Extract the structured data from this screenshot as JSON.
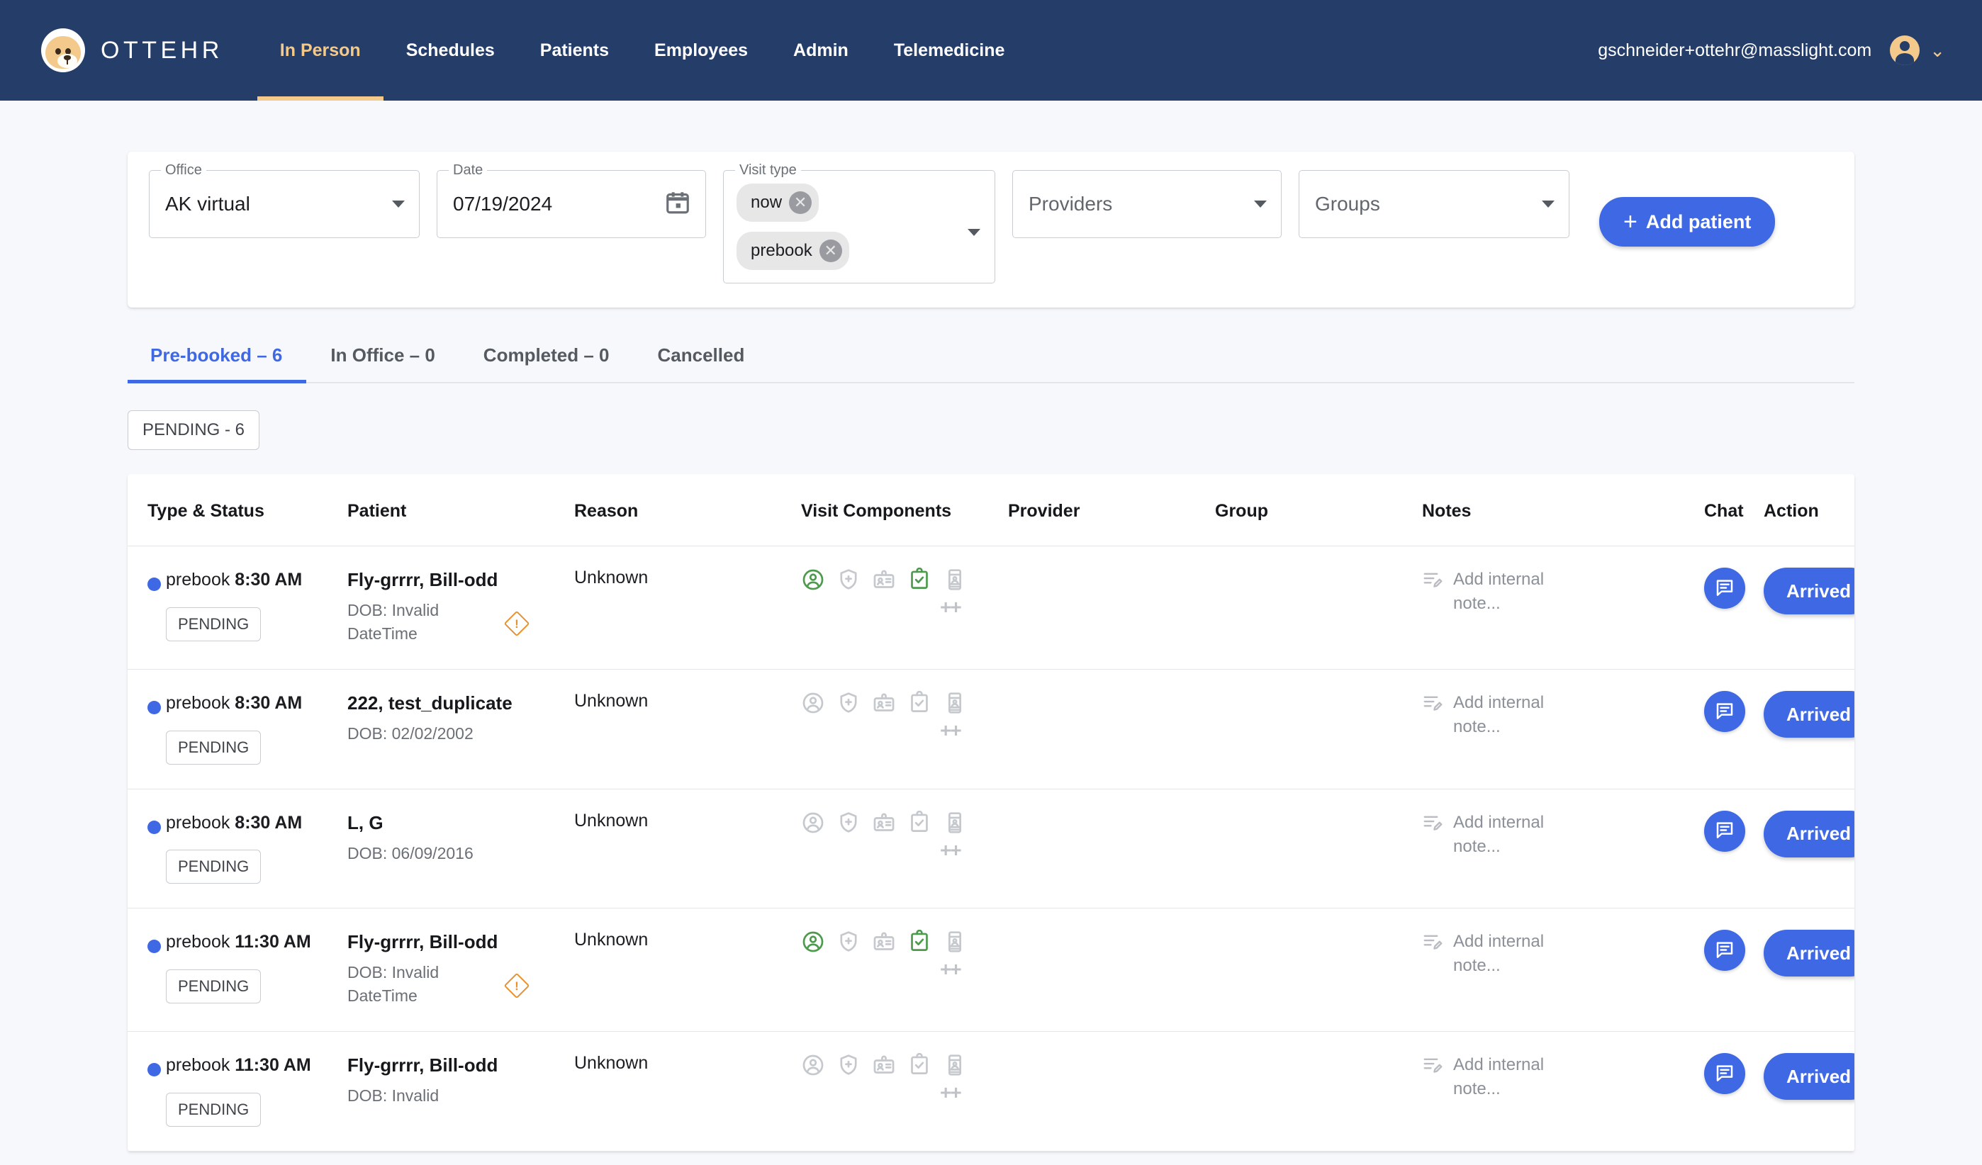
{
  "header": {
    "brand": "OTTEHR",
    "logo_icon": "otter-logo-icon",
    "nav": [
      {
        "label": "In Person",
        "active": true
      },
      {
        "label": "Schedules",
        "active": false
      },
      {
        "label": "Patients",
        "active": false
      },
      {
        "label": "Employees",
        "active": false
      },
      {
        "label": "Admin",
        "active": false
      },
      {
        "label": "Telemedicine",
        "active": false
      }
    ],
    "user_email": "gschneider+ottehr@masslight.com",
    "avatar_icon": "account-circle-icon",
    "user_menu_icon": "chevron-down-icon",
    "accent_color": "#F3CA8C",
    "background_color": "#253D69"
  },
  "filters": {
    "office": {
      "legend": "Office",
      "value": "AK virtual",
      "caret_icon": "chevron-down-icon"
    },
    "date": {
      "legend": "Date",
      "value": "07/19/2024",
      "icon": "calendar-icon"
    },
    "visit_type": {
      "legend": "Visit type",
      "chips": [
        "now",
        "prebook"
      ],
      "chip_remove_icon": "close-circle-icon",
      "caret_icon": "chevron-down-icon"
    },
    "providers": {
      "placeholder": "Providers",
      "caret_icon": "chevron-down-icon"
    },
    "groups": {
      "placeholder": "Groups",
      "caret_icon": "chevron-down-icon"
    },
    "add_patient": {
      "label": "Add patient",
      "plus_icon": "plus-icon",
      "color": "#3E68E4"
    }
  },
  "tabs": [
    {
      "label": "Pre-booked – 6",
      "active": true
    },
    {
      "label": "In Office – 0",
      "active": false
    },
    {
      "label": "Completed – 0",
      "active": false
    },
    {
      "label": "Cancelled",
      "active": false
    }
  ],
  "status_chip": "PENDING - 6",
  "table": {
    "columns": [
      "Type & Status",
      "Patient",
      "Reason",
      "Visit Components",
      "Provider",
      "Group",
      "Notes",
      "Chat",
      "Action"
    ],
    "note_placeholder": "Add internal note...",
    "note_icon": "note-edit-icon",
    "chat_icon": "chat-bubble-icon",
    "action_label": "Arrived",
    "warning_icon": "warning-diamond-icon",
    "component_icons": [
      "account-circle-icon",
      "shield-plus-icon",
      "id-badge-icon",
      "clipboard-check-icon",
      "mobile-photo-icon"
    ],
    "overflow_label": "++",
    "rows": [
      {
        "type": "prebook",
        "time": "8:30 AM",
        "status": "PENDING",
        "patient_name": "Fly-grrrr, Bill-odd",
        "dob": "DOB: Invalid DateTime",
        "dob_warning": true,
        "reason": "Unknown",
        "components_active": [
          true,
          false,
          false,
          true,
          false
        ],
        "provider": "",
        "group": ""
      },
      {
        "type": "prebook",
        "time": "8:30 AM",
        "status": "PENDING",
        "patient_name": "222, test_duplicate",
        "dob": "DOB: 02/02/2002",
        "dob_warning": false,
        "reason": "Unknown",
        "components_active": [
          false,
          false,
          false,
          false,
          false
        ],
        "provider": "",
        "group": ""
      },
      {
        "type": "prebook",
        "time": "8:30 AM",
        "status": "PENDING",
        "patient_name": "L, G",
        "dob": "DOB: 06/09/2016",
        "dob_warning": false,
        "reason": "Unknown",
        "components_active": [
          false,
          false,
          false,
          false,
          false
        ],
        "provider": "",
        "group": ""
      },
      {
        "type": "prebook",
        "time": "11:30 AM",
        "status": "PENDING",
        "patient_name": "Fly-grrrr, Bill-odd",
        "dob": "DOB: Invalid DateTime",
        "dob_warning": true,
        "reason": "Unknown",
        "components_active": [
          true,
          false,
          false,
          true,
          false
        ],
        "provider": "",
        "group": ""
      },
      {
        "type": "prebook",
        "time": "11:30 AM",
        "status": "PENDING",
        "patient_name": "Fly-grrrr, Bill-odd",
        "dob": "DOB: Invalid",
        "dob_warning": false,
        "reason": "Unknown",
        "components_active": [
          false,
          false,
          false,
          false,
          false
        ],
        "provider": "",
        "group": ""
      }
    ]
  }
}
